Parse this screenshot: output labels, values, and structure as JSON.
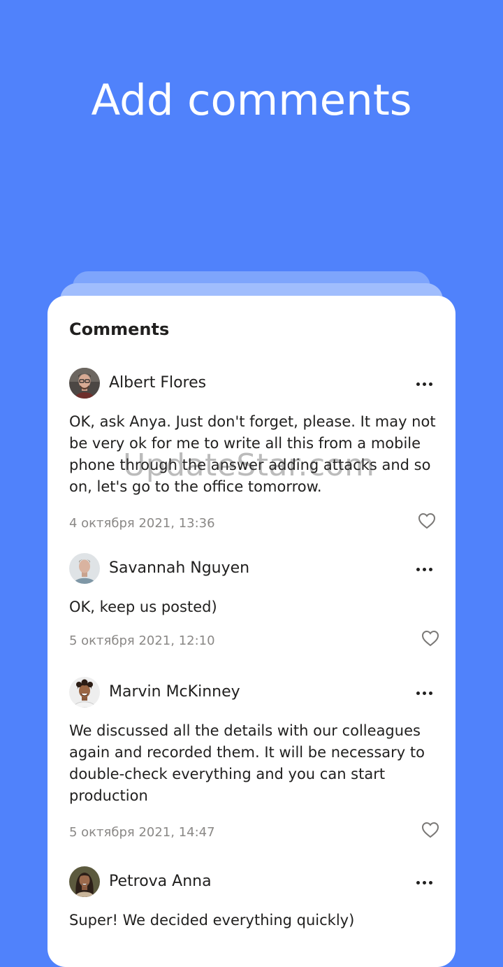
{
  "headline": "Add comments",
  "card": {
    "title": "Comments",
    "comments": [
      {
        "author": "Albert Flores",
        "text": "OK, ask Anya. Just don't forget, please. It may not be very ok for me to write all this from a mobile phone through the answer adding attacks and so on, let's go to the office tomorrow.",
        "date": "4 октября 2021, 13:36",
        "avatar_icon": "avatar-man-glasses"
      },
      {
        "author": "Savannah Nguyen",
        "text": "OK, keep us posted)",
        "date": "5 октября 2021, 12:10",
        "avatar_icon": "avatar-man"
      },
      {
        "author": "Marvin McKinney",
        "text": "We discussed all the details with our colleagues again and recorded them. It will be necessary to double-check everything and you can start production",
        "date": "5 октября 2021, 14:47",
        "avatar_icon": "avatar-man-curly"
      },
      {
        "author": "Petrova Anna",
        "text": "Super! We decided everything quickly)",
        "date": "",
        "avatar_icon": "avatar-woman"
      }
    ]
  },
  "watermark": "UpdateStar.com",
  "colors": {
    "background": "#5082fb",
    "card": "#ffffff",
    "text": "#21201f",
    "muted": "#8a8886"
  }
}
